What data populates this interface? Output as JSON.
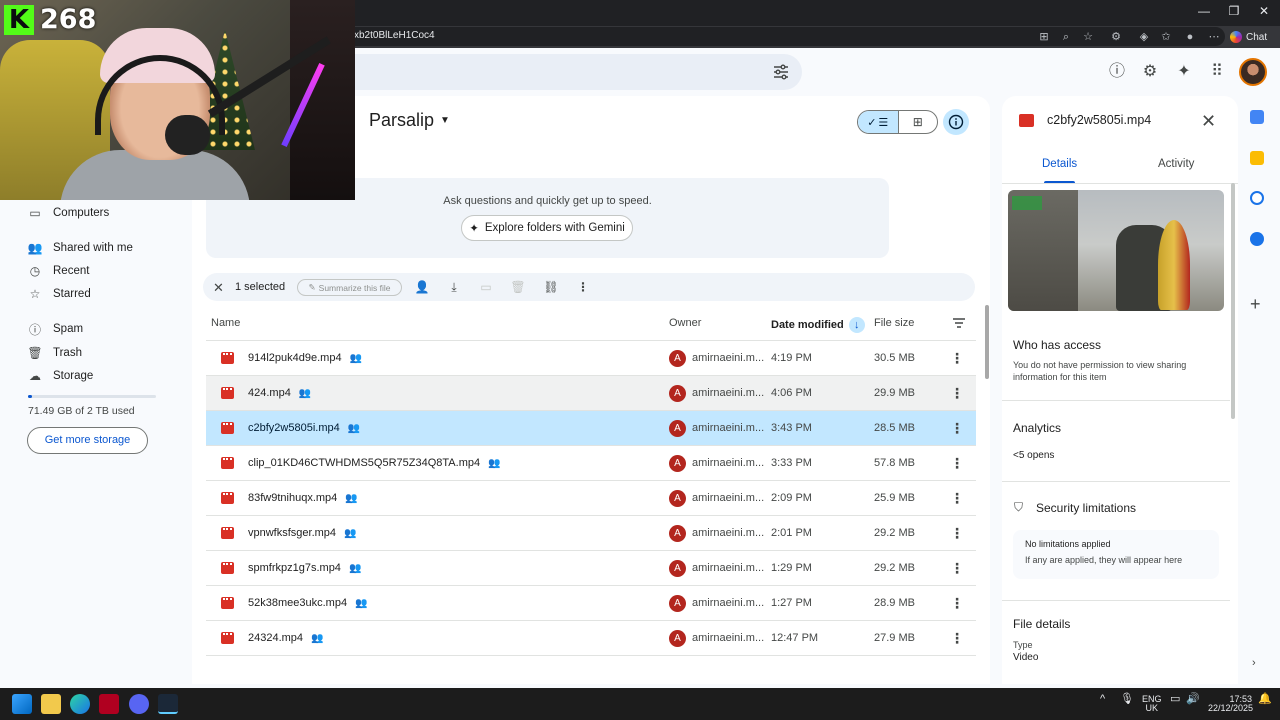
{
  "browser": {
    "url_fragment": "xb2t0BlLeH1Coc4",
    "chat_label": "Chat",
    "win_min": "—",
    "win_max": "❐",
    "win_close": "✕"
  },
  "stream_overlay": {
    "viewer_count": "268",
    "logo_letter": "K"
  },
  "sidebar": {
    "items": [
      {
        "label": "Computers",
        "icon": "computer-icon"
      },
      {
        "label": "Shared with me",
        "icon": "people-icon"
      },
      {
        "label": "Recent",
        "icon": "clock-icon"
      },
      {
        "label": "Starred",
        "icon": "star-icon"
      },
      {
        "label": "Spam",
        "icon": "spam-icon"
      },
      {
        "label": "Trash",
        "icon": "trash-icon"
      },
      {
        "label": "Storage",
        "icon": "cloud-icon"
      }
    ],
    "storage_used": "71.49 GB of 2 TB used",
    "storage_fraction": 0.035,
    "get_more_storage": "Get more storage"
  },
  "main": {
    "folder_title": "Parsalip",
    "gemini_prompt": "Ask questions and quickly get up to speed.",
    "gemini_button": "Explore folders with Gemini",
    "selection": {
      "count_label": "1 selected",
      "summarize_label": "Summarize this file"
    },
    "columns": {
      "name": "Name",
      "owner": "Owner",
      "date_modified": "Date modified",
      "file_size": "File size"
    },
    "files": [
      {
        "name": "914l2puk4d9e.mp4",
        "owner_initial": "A",
        "owner": "amirnaeini.m...",
        "date": "4:19 PM",
        "size": "30.5 MB"
      },
      {
        "name": "424.mp4",
        "owner_initial": "A",
        "owner": "amirnaeini.m...",
        "date": "4:06 PM",
        "size": "29.9 MB"
      },
      {
        "name": "c2bfy2w5805i.mp4",
        "owner_initial": "A",
        "owner": "amirnaeini.m...",
        "date": "3:43 PM",
        "size": "28.5 MB"
      },
      {
        "name": "clip_01KD46CTWHDMS5Q5R75Z34Q8TA.mp4",
        "owner_initial": "A",
        "owner": "amirnaeini.m...",
        "date": "3:33 PM",
        "size": "57.8 MB"
      },
      {
        "name": "83fw9tnihuqx.mp4",
        "owner_initial": "A",
        "owner": "amirnaeini.m...",
        "date": "2:09 PM",
        "size": "25.9 MB"
      },
      {
        "name": "vpnwfksfsger.mp4",
        "owner_initial": "A",
        "owner": "amirnaeini.m...",
        "date": "2:01 PM",
        "size": "29.2 MB"
      },
      {
        "name": "spmfrkpz1g7s.mp4",
        "owner_initial": "A",
        "owner": "amirnaeini.m...",
        "date": "1:29 PM",
        "size": "29.2 MB"
      },
      {
        "name": "52k38mee3ukc.mp4",
        "owner_initial": "A",
        "owner": "amirnaeini.m...",
        "date": "1:27 PM",
        "size": "28.9 MB"
      },
      {
        "name": "24324.mp4",
        "owner_initial": "A",
        "owner": "amirnaeini.m...",
        "date": "12:47 PM",
        "size": "27.9 MB"
      }
    ]
  },
  "details": {
    "file_name": "c2bfy2w5805i.mp4",
    "tabs": [
      "Details",
      "Activity"
    ],
    "who_has_access": "Who has access",
    "access_note": "You do not have permission to view sharing information for this item",
    "analytics": "Analytics",
    "opens": "<5 opens",
    "security": "Security limitations",
    "no_limitations": "No limitations applied",
    "limitations_note": "If any are applied, they will appear here",
    "file_details": "File details",
    "type_label": "Type",
    "type_value": "Video"
  },
  "taskbar": {
    "lang_top": "ENG",
    "lang_bottom": "UK",
    "time": "17:53",
    "date": "22/12/2025"
  },
  "colors": {
    "accent": "#0b57d0",
    "selected_row": "#c2e7ff",
    "video_icon": "#d93025",
    "owner_avatar": "#b3261e"
  }
}
